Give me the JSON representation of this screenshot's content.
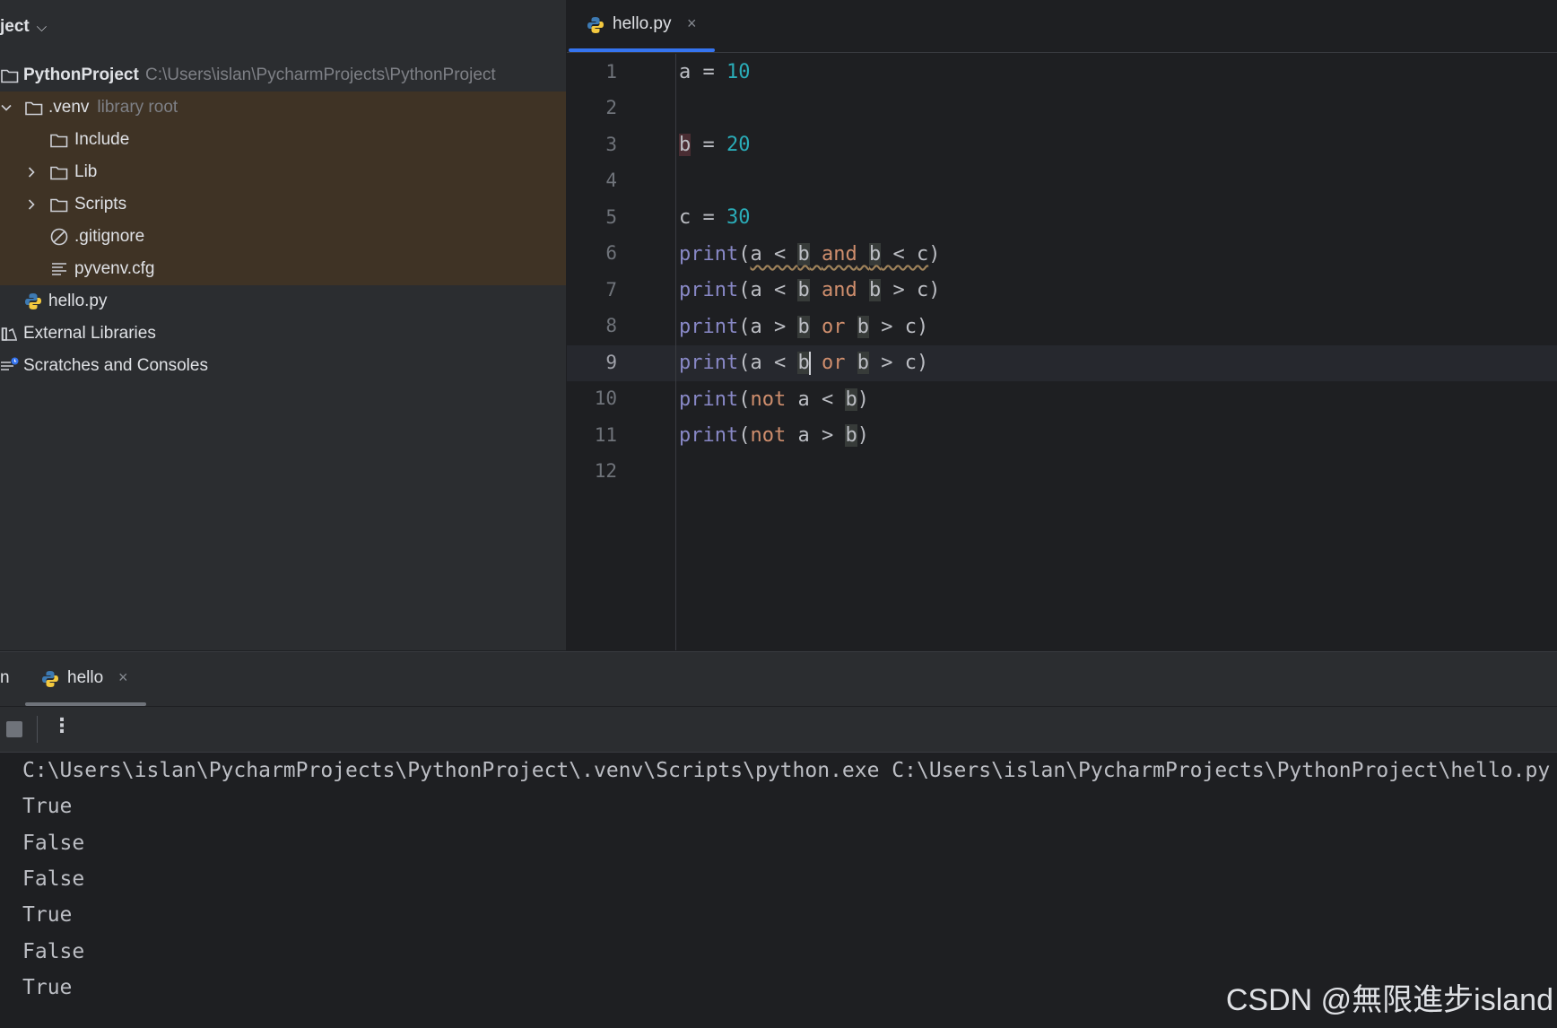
{
  "sidebar": {
    "header_title": "ject",
    "tree": {
      "root_name": "PythonProject",
      "root_path": "C:\\Users\\islan\\PycharmProjects\\PythonProject",
      "venv_name": ".venv",
      "venv_hint": "library root",
      "include": "Include",
      "lib": "Lib",
      "scripts": "Scripts",
      "gitignore": ".gitignore",
      "pyvenv": "pyvenv.cfg",
      "hello": "hello.py",
      "external_libraries": "External Libraries",
      "scratches": "Scratches and Consoles"
    }
  },
  "editor": {
    "tab_label": "hello.py",
    "tab_close": "×",
    "line_numbers": [
      "1",
      "2",
      "3",
      "4",
      "5",
      "6",
      "7",
      "8",
      "9",
      "10",
      "11",
      "12"
    ],
    "active_line": 9
  },
  "code": {
    "l1": {
      "var": "a",
      "op": " = ",
      "num": "10"
    },
    "l3": {
      "var": "b",
      "op": " = ",
      "num": "20"
    },
    "l5": {
      "var": "c",
      "op": " = ",
      "num": "30"
    },
    "fn": "print",
    "kw_and": "and",
    "kw_or": "or",
    "kw_not": "not"
  },
  "run": {
    "tab_cut": "n",
    "tab_label": "hello",
    "tab_close": "×",
    "more_label": "⋮",
    "command": "C:\\Users\\islan\\PycharmProjects\\PythonProject\\.venv\\Scripts\\python.exe C:\\Users\\islan\\PycharmProjects\\PythonProject\\hello.py",
    "output": [
      "True",
      "False",
      "False",
      "True",
      "False",
      "True"
    ]
  },
  "watermark": "CSDN @無限進步island",
  "colors": {
    "accent": "#3574f0",
    "number": "#2aacb8",
    "function": "#8888c6",
    "keyword": "#cf8e6d",
    "library_root_bg": "#3f3325"
  }
}
